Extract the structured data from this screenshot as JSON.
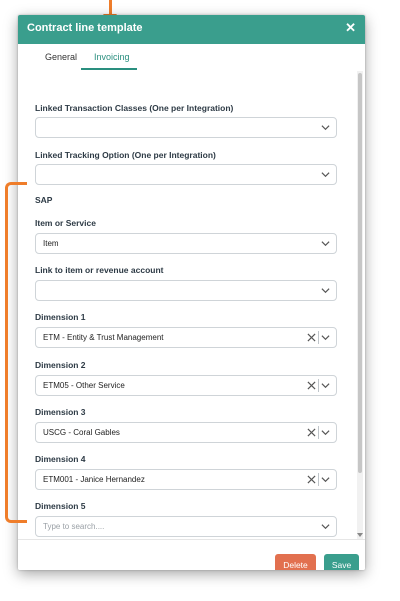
{
  "modal": {
    "title": "Contract line template",
    "close_symbol": "✕"
  },
  "tabs": [
    {
      "label": "General",
      "active": false
    },
    {
      "label": "Invoicing",
      "active": true
    }
  ],
  "form": {
    "linked_transaction_classes": {
      "label": "Linked Transaction Classes (One per Integration)",
      "value": ""
    },
    "linked_tracking_option": {
      "label": "Linked Tracking Option (One per Integration)",
      "value": ""
    },
    "section_title": "SAP",
    "item_or_service": {
      "label": "Item or Service",
      "value": "Item"
    },
    "link_to_item": {
      "label": "Link to item or revenue account",
      "value": ""
    },
    "dimension1": {
      "label": "Dimension 1",
      "value": "ETM - Entity & Trust Management"
    },
    "dimension2": {
      "label": "Dimension 2",
      "value": "ETM05 - Other Service"
    },
    "dimension3": {
      "label": "Dimension 3",
      "value": "USCG - Coral Gables"
    },
    "dimension4": {
      "label": "Dimension 4",
      "value": "ETM001 - Janice Hernandez"
    },
    "dimension5": {
      "label": "Dimension 5",
      "value": "",
      "placeholder": "Type to search...."
    }
  },
  "footer": {
    "delete_label": "Delete",
    "save_label": "Save"
  },
  "colors": {
    "header": "#3a9e8d",
    "active_tab": "#2a8f7f",
    "delete_button": "#e2704f",
    "save_button": "#3a9e8d",
    "annotation": "#ef7d2a"
  },
  "icons": [
    "close-icon",
    "chevron-down-icon",
    "clear-icon"
  ]
}
